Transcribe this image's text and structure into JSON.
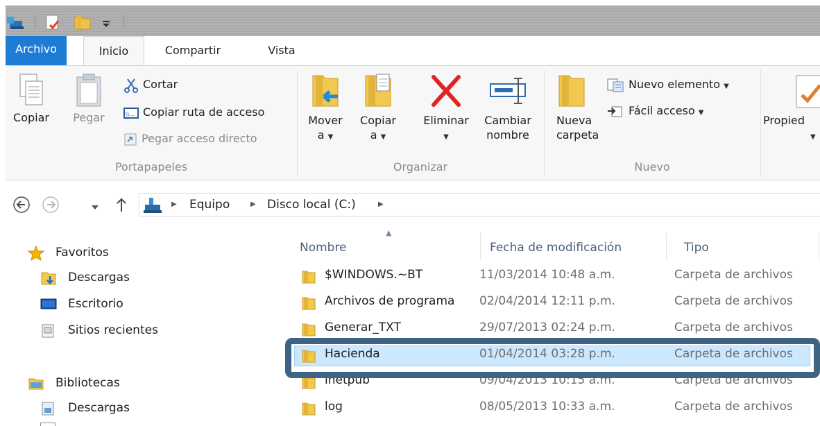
{
  "ribbon_tabs": [
    "Archivo",
    "Inicio",
    "Compartir",
    "Vista"
  ],
  "clipboard": {
    "copy_label": "Copiar",
    "paste_label": "Pegar",
    "cut_label": "Cortar",
    "copy_path_label": "Copiar ruta de acceso",
    "paste_shortcut_label": "Pegar acceso directo",
    "group_label": "Portapapeles"
  },
  "organize": {
    "move_label_1": "Mover",
    "move_label_2": "a",
    "copy_to_label_1": "Copiar",
    "copy_to_label_2": "a",
    "delete_label": "Eliminar",
    "rename_label_1": "Cambiar",
    "rename_label_2": "nombre",
    "group_label": "Organizar"
  },
  "new": {
    "new_folder_label_1": "Nueva",
    "new_folder_label_2": "carpeta",
    "new_item_label": "Nuevo elemento",
    "easy_access_label": "Fácil acceso",
    "group_label": "Nuevo"
  },
  "open": {
    "properties_label": "Propied"
  },
  "address": {
    "crumbs": [
      "Equipo",
      "Disco local (C:)"
    ]
  },
  "navpane": {
    "favorites_label": "Favoritos",
    "favorites_items": [
      "Descargas",
      "Escritorio",
      "Sitios recientes"
    ],
    "libraries_label": "Bibliotecas",
    "libraries_items": [
      "Descargas"
    ]
  },
  "columns": [
    "Nombre",
    "Fecha de modificación",
    "Tipo"
  ],
  "files": [
    {
      "name": "$WINDOWS.~BT",
      "date": "11/03/2014 10:48 a.m.",
      "type": "Carpeta de archivos"
    },
    {
      "name": "Archivos de programa",
      "date": "02/04/2014 12:11 p.m.",
      "type": "Carpeta de archivos"
    },
    {
      "name": "Generar_TXT",
      "date": "29/07/2013 02:24 p.m.",
      "type": "Carpeta de archivos"
    },
    {
      "name": "Hacienda",
      "date": "01/04/2014 03:28 p.m.",
      "type": "Carpeta de archivos"
    },
    {
      "name": "inetpub",
      "date": "09/04/2013 10:15 a.m.",
      "type": "Carpeta de archivos"
    },
    {
      "name": "log",
      "date": "08/05/2013 10:33 a.m.",
      "type": "Carpeta de archivos"
    }
  ],
  "selected_file": "Hacienda",
  "colors": {
    "file_tab": "#1d7dd6",
    "selection": "#cce8ff",
    "annotation": "#3f6382"
  }
}
